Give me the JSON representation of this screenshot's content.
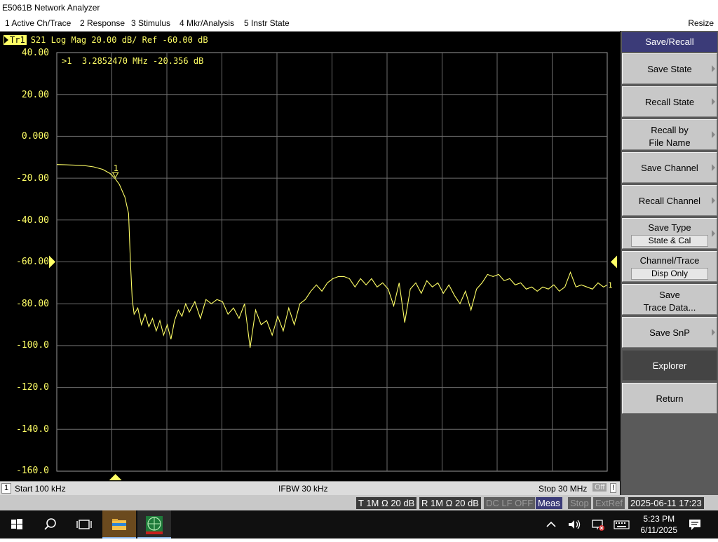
{
  "window": {
    "title": "E5061B Network Analyzer",
    "resize_label": "Resize"
  },
  "menu": [
    "1 Active Ch/Trace",
    "2 Response",
    "3 Stimulus",
    "4 Mkr/Analysis",
    "5 Instr State"
  ],
  "trace": {
    "badge": "Tr1",
    "header": "S21 Log Mag 20.00 dB/ Ref -60.00 dB",
    "marker_readout": ">1  3.2852470 MHz -20.356 dB",
    "marker_label": "1",
    "ref_end_label": "1",
    "color": "#ffff66"
  },
  "axis": {
    "y_ticks": [
      "40.00",
      "20.00",
      "0.000",
      "-20.00",
      "-40.00",
      "-60.00",
      "-80.00",
      "-100.0",
      "-120.0",
      "-140.0",
      "-160.0"
    ]
  },
  "chart_data": {
    "type": "line",
    "title": "",
    "xlabel": "",
    "ylabel": "",
    "xlim": [
      0.1,
      30
    ],
    "ylim": [
      -160,
      40
    ],
    "grid": true,
    "series": [
      {
        "name": "S21",
        "x": [
          0.1,
          0.6,
          1.1,
          1.6,
          2.1,
          2.6,
          3.0,
          3.285,
          3.5,
          3.8,
          4.0,
          4.1,
          4.2,
          4.3,
          4.5,
          4.7,
          4.9,
          5.1,
          5.3,
          5.5,
          5.7,
          5.9,
          6.1,
          6.3,
          6.5,
          6.7,
          6.9,
          7.1,
          7.3,
          7.6,
          7.9,
          8.2,
          8.5,
          8.8,
          9.1,
          9.4,
          9.7,
          10.0,
          10.3,
          10.6,
          10.9,
          11.2,
          11.5,
          11.8,
          12.1,
          12.4,
          12.7,
          13.0,
          13.3,
          13.6,
          13.9,
          14.2,
          14.5,
          14.8,
          15.1,
          15.4,
          15.7,
          16.0,
          16.3,
          16.6,
          16.9,
          17.2,
          17.5,
          17.8,
          18.1,
          18.4,
          18.7,
          19.0,
          19.3,
          19.6,
          19.9,
          20.2,
          20.5,
          20.8,
          21.1,
          21.4,
          21.7,
          22.0,
          22.3,
          22.6,
          22.9,
          23.2,
          23.5,
          23.8,
          24.1,
          24.4,
          24.7,
          25.0,
          25.3,
          25.6,
          25.9,
          26.2,
          26.5,
          26.8,
          27.1,
          27.4,
          27.7,
          28.0,
          28.3,
          28.6,
          28.9,
          29.2,
          29.5,
          29.8,
          30.0
        ],
        "values": [
          -13.5,
          -13.6,
          -13.8,
          -14.0,
          -14.6,
          -15.8,
          -17.8,
          -20.356,
          -23,
          -29,
          -37,
          -60,
          -78,
          -85,
          -82,
          -90,
          -85,
          -91,
          -87,
          -93,
          -88,
          -95,
          -90,
          -97,
          -88,
          -83,
          -86,
          -80,
          -84,
          -79,
          -87,
          -78,
          -80,
          -78,
          -79,
          -85,
          -82,
          -87,
          -80,
          -101,
          -83,
          -90,
          -88,
          -95,
          -86,
          -93,
          -82,
          -90,
          -80,
          -78,
          -74,
          -71,
          -74,
          -70,
          -68,
          -67,
          -67,
          -68,
          -72,
          -68,
          -71,
          -68,
          -72,
          -70,
          -73,
          -81,
          -70,
          -89,
          -73,
          -70,
          -75,
          -69,
          -72,
          -70,
          -75,
          -71,
          -76,
          -80,
          -74,
          -83,
          -73,
          -70,
          -66,
          -67,
          -66,
          -69,
          -68,
          -71,
          -70,
          -73,
          -72,
          -74,
          -72,
          -73,
          -71,
          -74,
          -72,
          -65,
          -72,
          -71,
          -72,
          -73,
          -70,
          -72,
          -71
        ]
      }
    ],
    "marker": {
      "id": "1",
      "x": 3.285247,
      "y": -20.356,
      "unit_x": "MHz",
      "unit_y": "dB"
    },
    "ref_level": -60,
    "scale_per_div": 20
  },
  "status_line": {
    "channel": "1",
    "start": "Start 100 kHz",
    "ifbw": "IFBW 30 kHz",
    "stop": "Stop 30 MHz",
    "off": "Off",
    "bang": "!"
  },
  "instr_status": [
    {
      "label": "T 1M Ω 20 dB",
      "state": "normal"
    },
    {
      "label": "R 1M Ω 20 dB",
      "state": "normal"
    },
    {
      "label": "DC LF OFF",
      "state": "dim"
    },
    {
      "label": "Meas",
      "state": "active"
    },
    {
      "label": "Stop",
      "state": "dim"
    },
    {
      "label": "ExtRef",
      "state": "dim"
    },
    {
      "label": "2025-06-11 17:23",
      "state": "normal"
    }
  ],
  "softkeys": {
    "title": "Save/Recall",
    "items": [
      {
        "label": "Save State",
        "arrow": true
      },
      {
        "label": "Recall State",
        "arrow": true
      },
      {
        "label": "Recall by\nFile Name",
        "arrow": true
      },
      {
        "label": "Save Channel",
        "arrow": true
      },
      {
        "label": "Recall Channel",
        "arrow": true
      },
      {
        "label": "Save Type",
        "sub": "State & Cal",
        "arrow": true
      },
      {
        "label": "Channel/Trace",
        "sub": "Disp Only",
        "arrow": false
      },
      {
        "label": "Save\nTrace Data...",
        "arrow": false
      },
      {
        "label": "Save SnP",
        "arrow": true
      },
      {
        "label": "Explorer",
        "arrow": false,
        "dark": true
      },
      {
        "label": "Return",
        "arrow": false
      }
    ]
  },
  "taskbar": {
    "time": "5:23 PM",
    "date": "6/11/2025",
    "icons": [
      "windows-start-icon",
      "search-icon",
      "task-view-icon",
      "file-explorer-icon",
      "network-analyzer-app-icon"
    ],
    "tray_icons": [
      "chevron-up-icon",
      "speaker-icon",
      "network-icon",
      "keyboard-icon",
      "notification-icon"
    ]
  }
}
